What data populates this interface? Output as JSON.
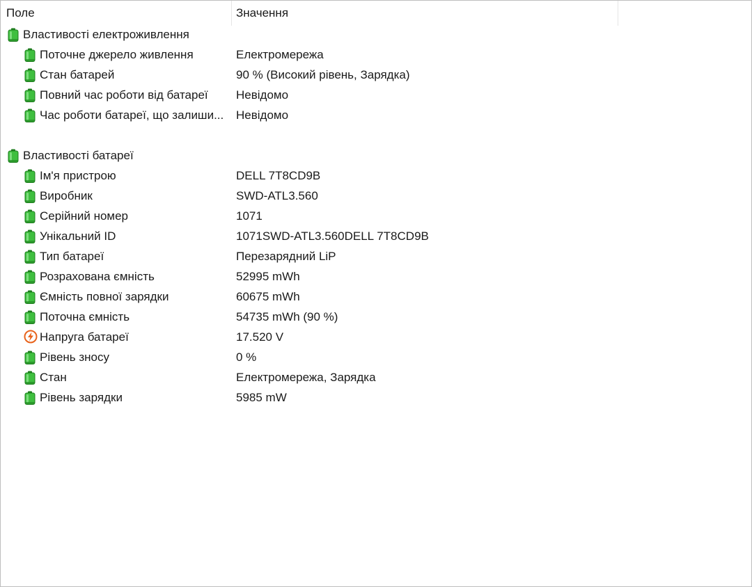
{
  "columns": {
    "field": "Поле",
    "value": "Значення"
  },
  "groups": [
    {
      "title": "Властивості електроживлення",
      "icon": "battery-icon",
      "items": [
        {
          "label": "Поточне джерело живлення",
          "value": "Електромережа",
          "icon": "battery-icon"
        },
        {
          "label": "Стан батарей",
          "value": "90 % (Високий рівень, Зарядка)",
          "icon": "battery-icon"
        },
        {
          "label": "Повний час роботи від батареї",
          "value": "Невідомо",
          "icon": "battery-icon"
        },
        {
          "label": "Час роботи батареї, що залиши...",
          "value": "Невідомо",
          "icon": "battery-icon"
        }
      ]
    },
    {
      "title": "Властивості батареї",
      "icon": "battery-icon",
      "items": [
        {
          "label": "Ім'я пристрою",
          "value": "DELL 7T8CD9B",
          "icon": "battery-icon"
        },
        {
          "label": "Виробник",
          "value": "SWD-ATL3.560",
          "icon": "battery-icon"
        },
        {
          "label": "Серійний номер",
          "value": "1071",
          "icon": "battery-icon"
        },
        {
          "label": "Унікальний ID",
          "value": "1071SWD-ATL3.560DELL 7T8CD9B",
          "icon": "battery-icon"
        },
        {
          "label": "Тип батареї",
          "value": "Перезарядний LiP",
          "icon": "battery-icon"
        },
        {
          "label": "Розрахована ємність",
          "value": "52995 mWh",
          "icon": "battery-icon"
        },
        {
          "label": "Ємність повної зарядки",
          "value": "60675 mWh",
          "icon": "battery-icon"
        },
        {
          "label": "Поточна ємність",
          "value": "54735 mWh  (90 %)",
          "icon": "battery-icon"
        },
        {
          "label": "Напруга батареї",
          "value": "17.520 V",
          "icon": "voltage-icon"
        },
        {
          "label": "Рівень зносу",
          "value": "0 %",
          "icon": "battery-icon"
        },
        {
          "label": "Стан",
          "value": "Електромережа, Зарядка",
          "icon": "battery-icon"
        },
        {
          "label": "Рівень зарядки",
          "value": "5985 mW",
          "icon": "battery-icon"
        }
      ]
    }
  ],
  "colors": {
    "battery_body": "#3fbf3f",
    "battery_dark": "#1e7d1e",
    "voltage_ring": "#e8621a",
    "text": "#1a1a1a"
  }
}
